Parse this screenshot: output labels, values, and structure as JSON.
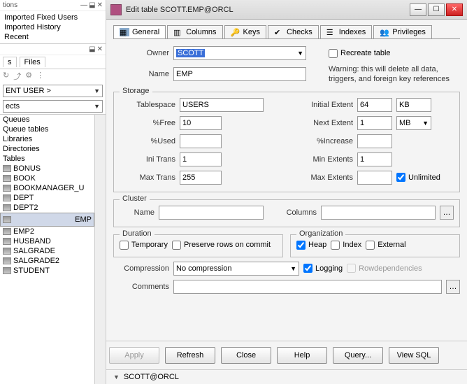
{
  "left": {
    "panel_title_suffix": "tions",
    "imports": [
      "Imported Fixed Users",
      "Imported History",
      "Recent"
    ],
    "files_tab": "Files",
    "current_user": "ENT USER >",
    "objects": "ects",
    "categories": [
      "Queues",
      "Queue tables",
      "Libraries",
      "Directories",
      "Tables"
    ],
    "tables": [
      "BONUS",
      "BOOK",
      "BOOKMANAGER_U",
      "DEPT",
      "DEPT2",
      "EMP",
      "EMP2",
      "HUSBAND",
      "SALGRADE",
      "SALGRADE2",
      "STUDENT"
    ],
    "selected_table": "EMP"
  },
  "dialog": {
    "title": "Edit table SCOTT.EMP@ORCL",
    "tabs": {
      "general": "General",
      "columns": "Columns",
      "keys": "Keys",
      "checks": "Checks",
      "indexes": "Indexes",
      "privileges": "Privileges"
    },
    "owner_label": "Owner",
    "owner_value": "SCOTT",
    "name_label": "Name",
    "name_value": "EMP",
    "recreate_label": "Recreate table",
    "warning": "Warning: this will delete all data, triggers, and foreign key references",
    "storage": {
      "legend": "Storage",
      "tablespace_label": "Tablespace",
      "tablespace_value": "USERS",
      "pctfree_label": "%Free",
      "pctfree_value": "10",
      "pctused_label": "%Used",
      "pctused_value": "",
      "initrans_label": "Ini Trans",
      "initrans_value": "1",
      "maxtrans_label": "Max Trans",
      "maxtrans_value": "255",
      "initial_extent_label": "Initial Extent",
      "initial_extent_value": "64",
      "initial_extent_unit": "KB",
      "next_extent_label": "Next Extent",
      "next_extent_value": "1",
      "next_extent_unit": "MB",
      "pctincrease_label": "%Increase",
      "pctincrease_value": "",
      "min_extents_label": "Min Extents",
      "min_extents_value": "1",
      "max_extents_label": "Max Extents",
      "max_extents_value": "",
      "unlimited_label": "Unlimited"
    },
    "cluster": {
      "legend": "Cluster",
      "name_label": "Name",
      "columns_label": "Columns"
    },
    "duration": {
      "legend": "Duration",
      "temporary_label": "Temporary",
      "preserve_label": "Preserve rows on commit"
    },
    "organization": {
      "legend": "Organization",
      "heap": "Heap",
      "index": "Index",
      "external": "External"
    },
    "compression_label": "Compression",
    "compression_value": "No compression",
    "logging_label": "Logging",
    "rowdeps_label": "Rowdependencies",
    "comments_label": "Comments",
    "comments_value": "",
    "buttons": {
      "apply": "Apply",
      "refresh": "Refresh",
      "close": "Close",
      "help": "Help",
      "query": "Query...",
      "viewsql": "View SQL"
    }
  },
  "status": "SCOTT@ORCL"
}
